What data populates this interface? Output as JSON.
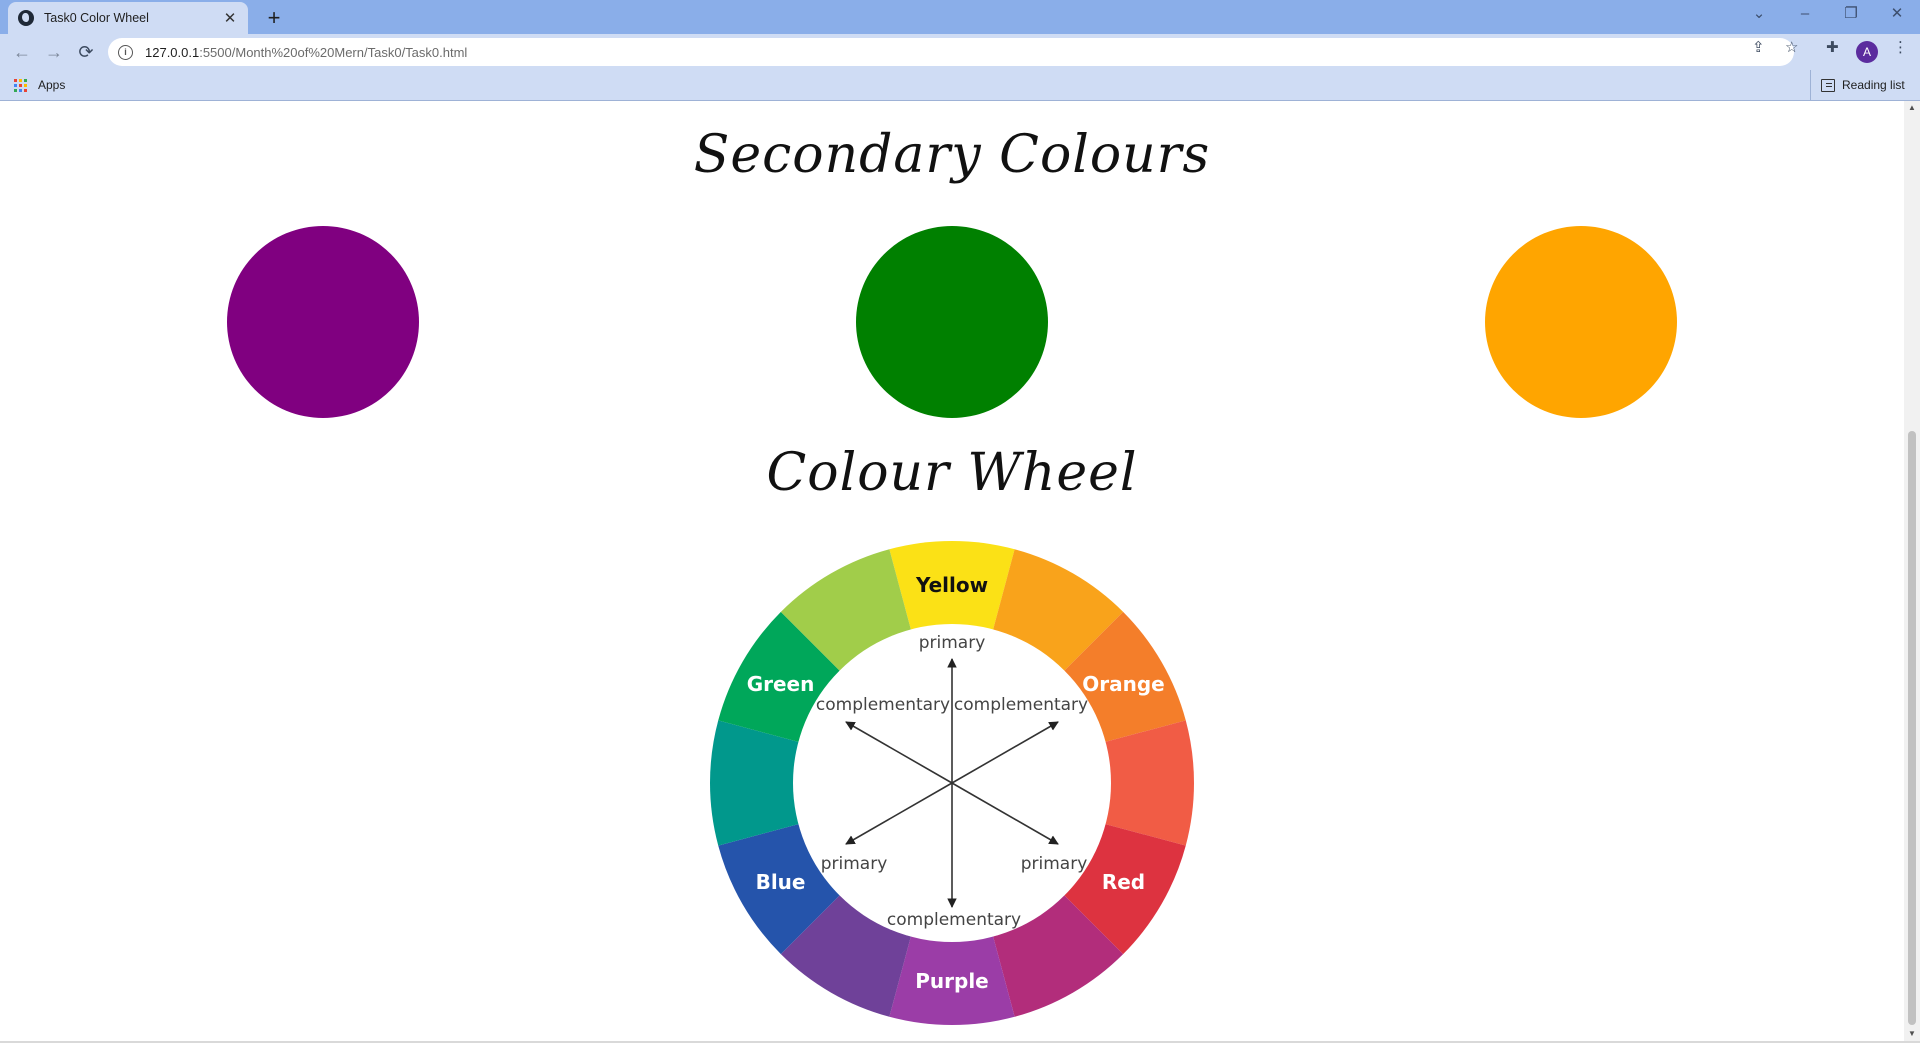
{
  "browser": {
    "tab_title": "Task0 Color Wheel",
    "tab_close": "✕",
    "new_tab": "+",
    "window": {
      "chevron": "⌄",
      "minimize": "–",
      "restore": "❐",
      "close": "✕"
    },
    "nav": {
      "back": "←",
      "forward": "→",
      "reload": "⟳"
    },
    "url_host": "127.0.0.1",
    "url_path": ":5500/Month%20of%20Mern/Task0/Task0.html",
    "omnibox_icons": {
      "share": "⇪",
      "bookmark": "☆",
      "extensions": "✚",
      "menu": "⋮"
    },
    "avatar_initial": "A",
    "bookmarks": {
      "apps_label": "Apps",
      "reading_list_label": "Reading list"
    }
  },
  "page": {
    "secondary_heading": "Secondary Colours",
    "wheel_heading": "Colour Wheel",
    "secondary_colors": [
      "#800080",
      "#008000",
      "#ffa500"
    ]
  },
  "wheel": {
    "segments": [
      {
        "color": "#fbe116",
        "label": "Yellow",
        "label_color": "#111111"
      },
      {
        "color": "#f9a31b",
        "label": "",
        "label_color": "#ffffff"
      },
      {
        "color": "#f47e2a",
        "label": "Orange",
        "label_color": "#ffffff"
      },
      {
        "color": "#f15c45",
        "label": "",
        "label_color": "#ffffff"
      },
      {
        "color": "#dd3340",
        "label": "Red",
        "label_color": "#ffffff"
      },
      {
        "color": "#b22d7b",
        "label": "",
        "label_color": "#ffffff"
      },
      {
        "color": "#9b3da7",
        "label": "Purple",
        "label_color": "#ffffff"
      },
      {
        "color": "#6f4199",
        "label": "",
        "label_color": "#ffffff"
      },
      {
        "color": "#2554ab",
        "label": "Blue",
        "label_color": "#ffffff"
      },
      {
        "color": "#01988c",
        "label": "",
        "label_color": "#ffffff"
      },
      {
        "color": "#00a75a",
        "label": "Green",
        "label_color": "#ffffff"
      },
      {
        "color": "#a1cd4a",
        "label": "",
        "label_color": "#ffffff"
      }
    ],
    "inner_labels": {
      "top": "primary",
      "upper_left": "complementary",
      "upper_right": "complementary",
      "lower_left": "primary",
      "lower_right": "primary",
      "bottom": "complementary"
    }
  }
}
